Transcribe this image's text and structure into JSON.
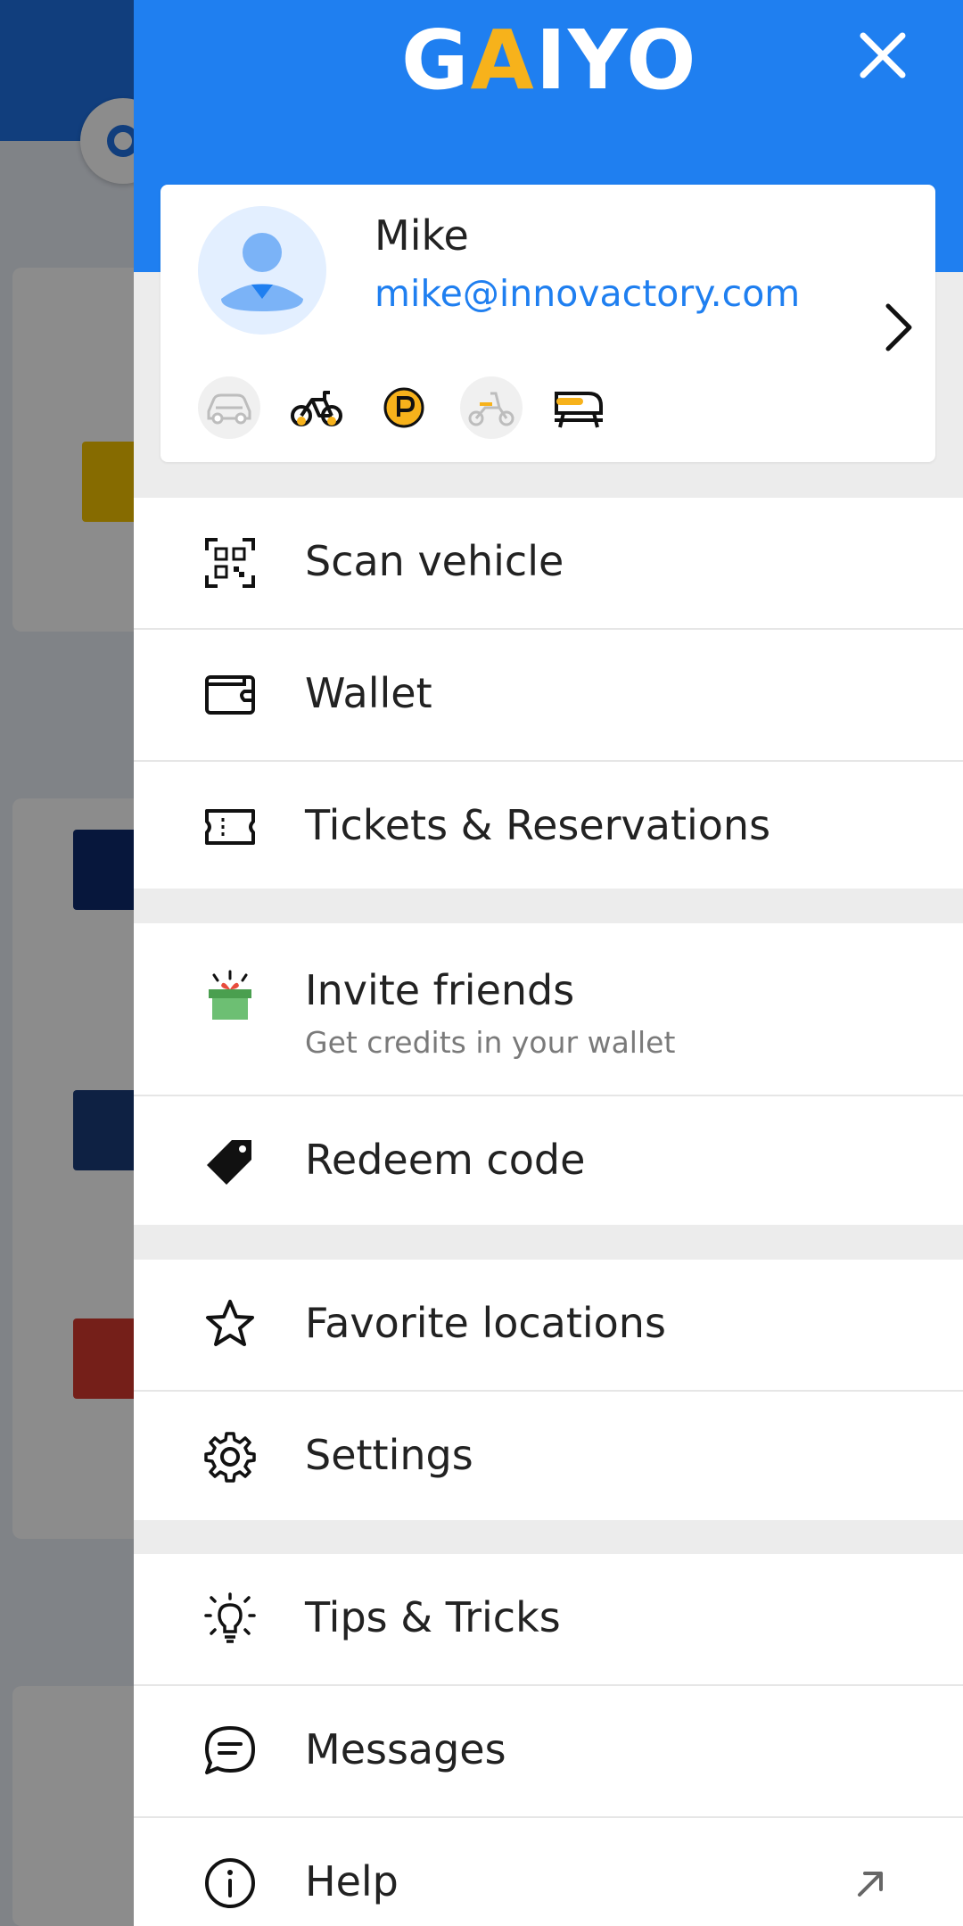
{
  "app": {
    "logo_text_1": "G",
    "logo_text_a": "A",
    "logo_text_2": "IYO"
  },
  "profile": {
    "name": "Mike",
    "email": "mike@innovactory.com"
  },
  "mode_icons": [
    "car-icon",
    "bike-icon",
    "parking-icon",
    "scooter-icon",
    "train-icon"
  ],
  "menu": {
    "scan": {
      "label": "Scan vehicle"
    },
    "wallet": {
      "label": "Wallet"
    },
    "tickets": {
      "label": "Tickets & Reservations"
    },
    "invite": {
      "label": "Invite friends",
      "sub": "Get credits in your wallet"
    },
    "redeem": {
      "label": "Redeem code"
    },
    "favorites": {
      "label": "Favorite locations"
    },
    "settings": {
      "label": "Settings"
    },
    "tips": {
      "label": "Tips & Tricks"
    },
    "messages": {
      "label": "Messages"
    },
    "help": {
      "label": "Help"
    }
  },
  "colors": {
    "brand_blue": "#1f7ff0",
    "accent_yellow": "#f7b21b",
    "link_blue": "#1f7ff0"
  }
}
